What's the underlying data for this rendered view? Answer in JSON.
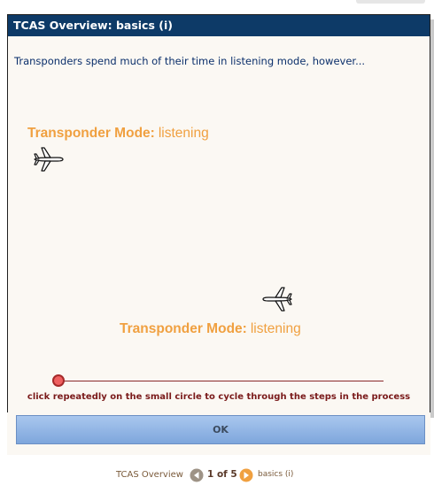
{
  "dialog": {
    "title": "TCAS Overview: basics (i)",
    "description": "Transponders spend much of their time in listening mode, however...",
    "aircraft_1": {
      "mode_key": "Transponder Mode:",
      "mode_value": "listening",
      "icon": "airplane-icon"
    },
    "aircraft_2": {
      "mode_key": "Transponder Mode:",
      "mode_value": "listening",
      "icon": "airplane-icon"
    },
    "hint": "click repeatedly on the small circle to cycle through the steps in the process"
  },
  "ok_label": "OK",
  "pager": {
    "left_label": "TCAS Overview",
    "count": "1 of 5",
    "right_label": "basics (i)"
  },
  "colors": {
    "titlebar": "#0d3a67",
    "accent_orange": "#f0a040",
    "hint_text": "#7a1a1a",
    "step_dot": "#ef6060",
    "ok_button": "#90b4e6"
  }
}
